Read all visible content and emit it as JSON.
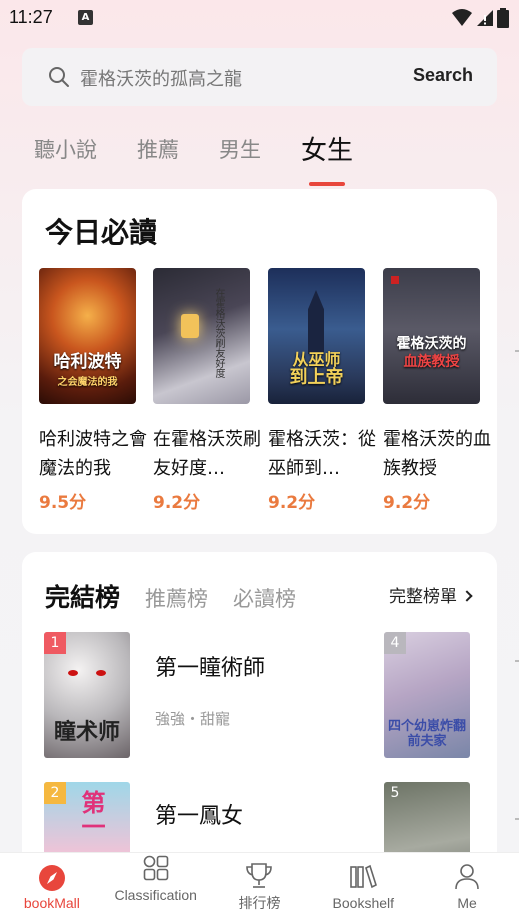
{
  "status": {
    "time": "11:27",
    "notification_letter": "A"
  },
  "search": {
    "placeholder": "霍格沃茨的孤高之龍",
    "button": "Search"
  },
  "top_tabs": [
    {
      "label": "聽小說",
      "active": false
    },
    {
      "label": "推薦",
      "active": false
    },
    {
      "label": "男生",
      "active": false
    },
    {
      "label": "女生",
      "active": true
    }
  ],
  "daily": {
    "title": "今日必讀",
    "books": [
      {
        "title": "哈利波特之會魔法的我",
        "score": "9.5分",
        "cover_text": "哈利波特",
        "cover_sub": "之会魔法的我"
      },
      {
        "title": "在霍格沃茨刷友好度…",
        "score": "9.2分",
        "cover_text": "在霍格沃茨刷友好度",
        "cover_sub": ""
      },
      {
        "title": "霍格沃茨：從巫師到…",
        "score": "9.2分",
        "cover_text": "从巫师",
        "cover_sub": "到上帝"
      },
      {
        "title": "霍格沃茨的血族教授",
        "score": "9.2分",
        "cover_text": "霍格沃茨的",
        "cover_sub": "血族教授"
      }
    ]
  },
  "ranking": {
    "tabs": [
      {
        "label": "完結榜",
        "active": true
      },
      {
        "label": "推薦榜",
        "active": false
      },
      {
        "label": "必讀榜",
        "active": false
      }
    ],
    "full_list": "完整榜單",
    "items": [
      {
        "rank": "1",
        "title": "第一瞳術師",
        "tags": "強強・甜寵",
        "cover_text": "瞳术师"
      },
      {
        "rank": "2",
        "title": "第一鳳女",
        "tags": "",
        "cover_text": "第一"
      }
    ],
    "right_items": [
      {
        "rank": "4",
        "cover_text": "四个幼崽炸翻前夫家"
      },
      {
        "rank": "5",
        "cover_text": ""
      }
    ]
  },
  "nav": [
    {
      "label": "bookMall",
      "icon": "compass-icon",
      "active": true
    },
    {
      "label": "Classification",
      "icon": "grid-icon",
      "active": false
    },
    {
      "label": "排行榜",
      "icon": "trophy-icon",
      "active": false
    },
    {
      "label": "Bookshelf",
      "icon": "bookshelf-icon",
      "active": false
    },
    {
      "label": "Me",
      "icon": "person-icon",
      "active": false
    }
  ],
  "colors": {
    "accent": "#e8463c",
    "score": "#ea7a3f"
  }
}
